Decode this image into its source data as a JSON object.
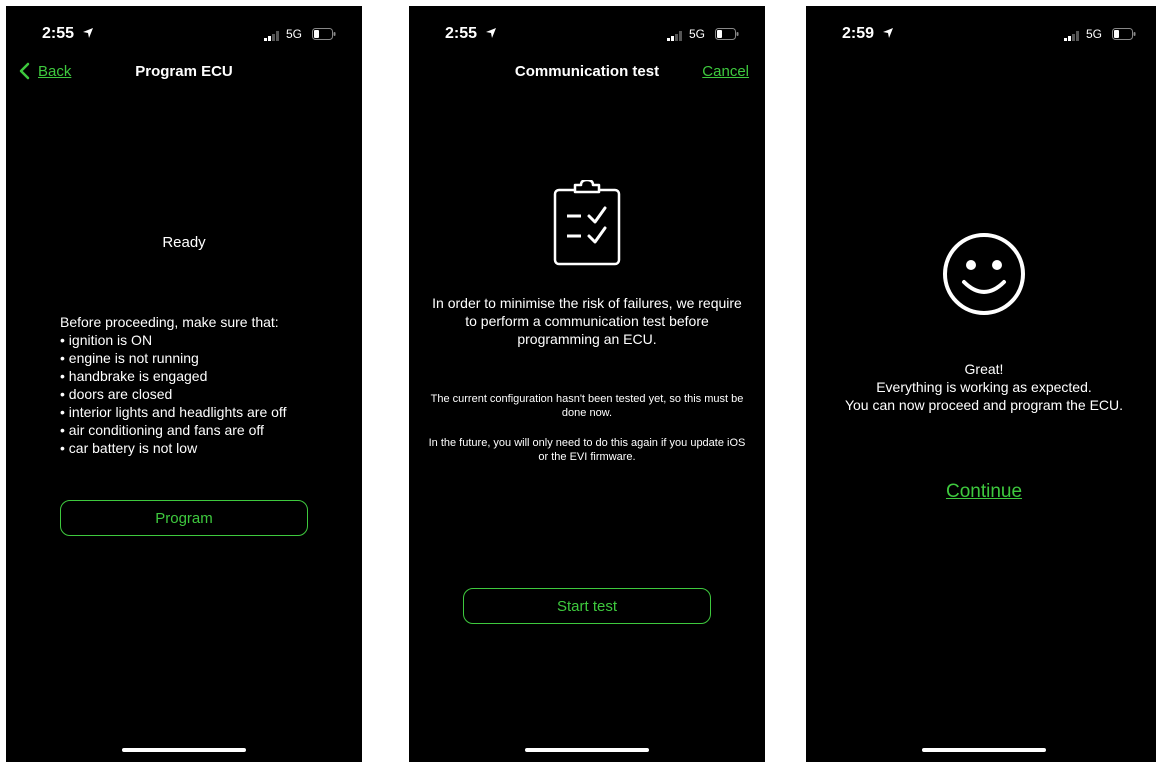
{
  "colors": {
    "accent": "#3ec93e",
    "background": "#000000",
    "text": "#ffffff"
  },
  "screens": [
    {
      "status": {
        "time": "2:55",
        "network": "5G"
      },
      "nav": {
        "back_label": "Back",
        "title": "Program ECU"
      },
      "status_text": "Ready",
      "checklist_heading": "Before proceeding, make sure that:",
      "checklist": [
        "ignition is ON",
        "engine is not running",
        "handbrake is engaged",
        "doors are closed",
        "interior lights and headlights are off",
        "air conditioning and fans are off",
        "car battery is not low"
      ],
      "button_label": "Program"
    },
    {
      "status": {
        "time": "2:55",
        "network": "5G"
      },
      "nav": {
        "title": "Communication test",
        "cancel_label": "Cancel"
      },
      "icon": "clipboard-check-icon",
      "intro": "In order to minimise the risk of failures, we require to perform a communication test before programming an ECU.",
      "note1": "The current configuration hasn't been tested yet, so this must be done now.",
      "note2": "In the future, you will only need to do this again if you update iOS or the EVI firmware.",
      "button_label": "Start test"
    },
    {
      "status": {
        "time": "2:59",
        "network": "5G"
      },
      "icon": "smiley-face-icon",
      "message_title": "Great!",
      "message_line1": "Everything is working as expected.",
      "message_line2": "You can now proceed and program the ECU.",
      "continue_label": "Continue"
    }
  ]
}
